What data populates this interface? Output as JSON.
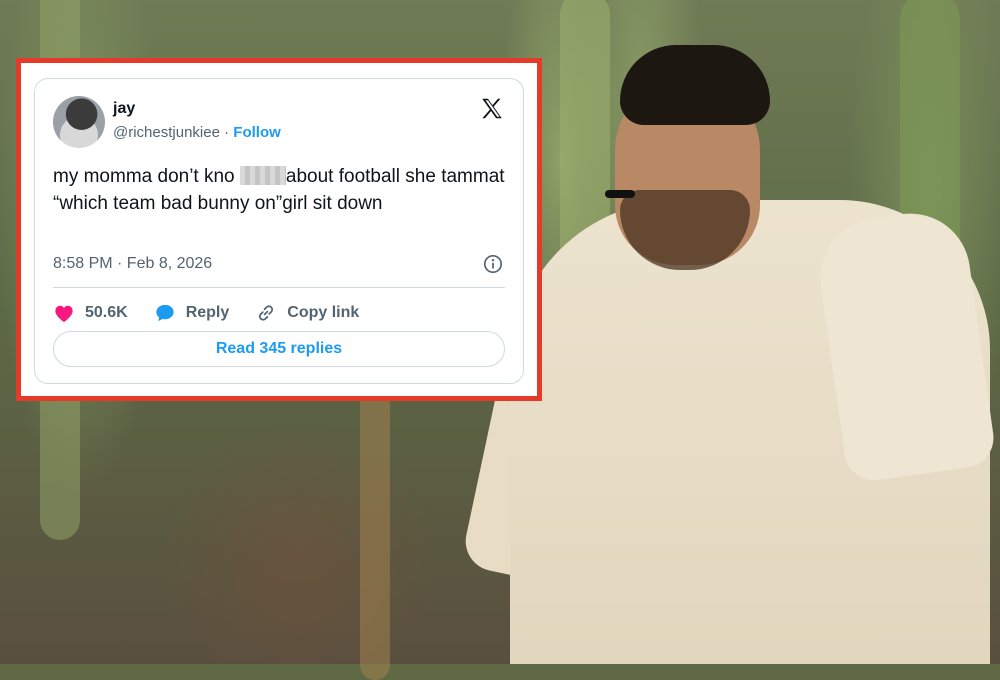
{
  "tweet": {
    "author_name": "jay",
    "handle": "@richestjunkiee",
    "separator": "·",
    "follow_label": "Follow",
    "text_part1": "my momma don’t kno ",
    "text_part2": "about football she tammat “which team bad bunny on”girl sit down",
    "timestamp": "8:58 PM · Feb 8, 2026",
    "like_count": "50.6K",
    "reply_label": "Reply",
    "copy_link_label": "Copy link",
    "read_replies_label": "Read 345 replies"
  },
  "icons": {
    "brand": "x-logo-icon",
    "info": "info-icon",
    "like": "heart-icon",
    "reply": "speech-bubble-icon",
    "copy": "link-icon"
  },
  "colors": {
    "frame_border": "#e53a2a",
    "link_blue": "#1d9bf0",
    "like_pink": "#f91880",
    "muted_text": "#536471"
  }
}
